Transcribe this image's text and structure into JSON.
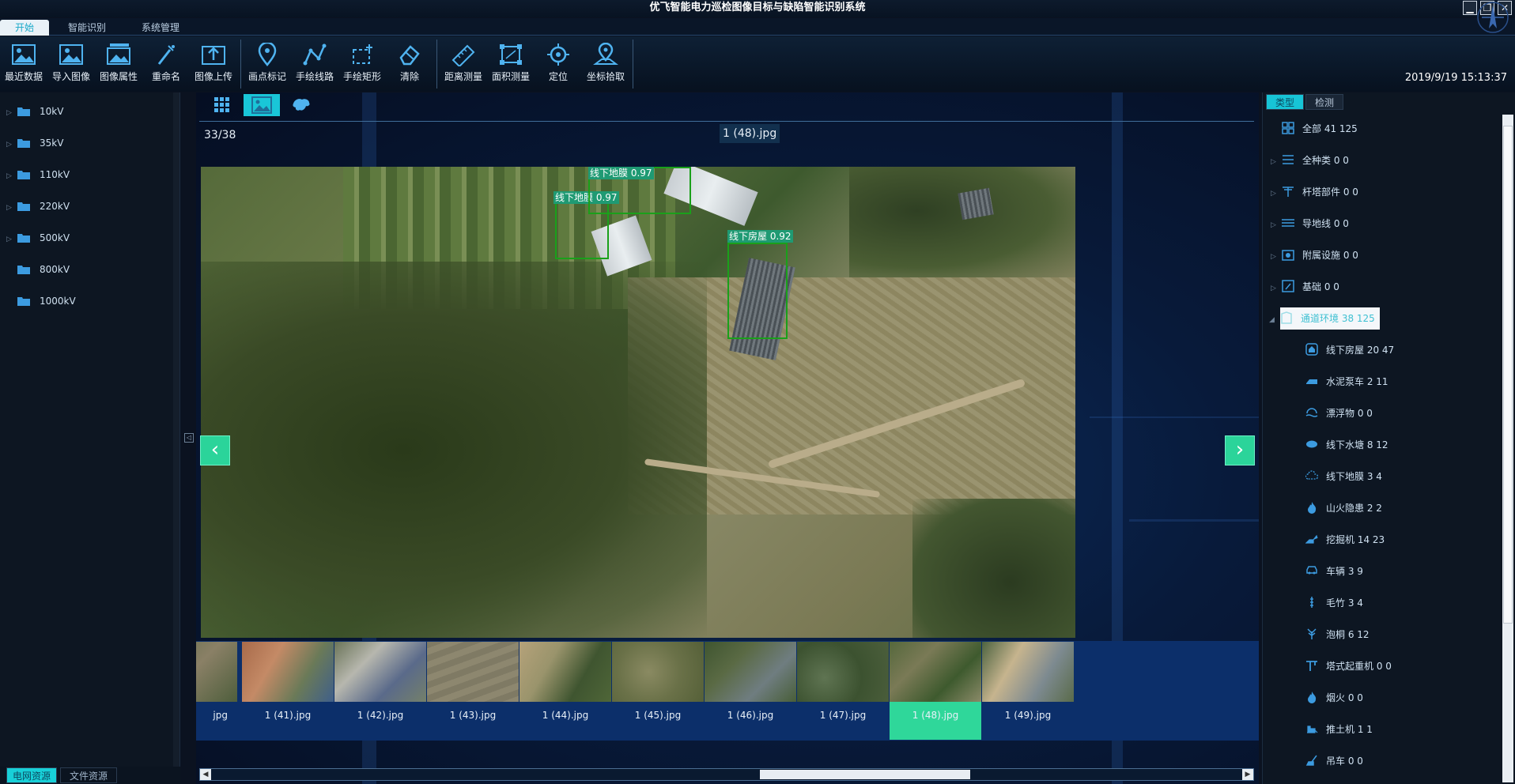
{
  "window": {
    "title": "优飞智能电力巡检图像目标与缺陷智能识别系统",
    "controls": [
      "▁",
      "❐",
      "✕"
    ]
  },
  "menu": [
    {
      "label": "开始",
      "active": true
    },
    {
      "label": "智能识别",
      "active": false
    },
    {
      "label": "系统管理",
      "active": false
    }
  ],
  "toolbar": {
    "groups": [
      [
        {
          "label": "最近数据",
          "icon": "recent-data-icon"
        },
        {
          "label": "导入图像",
          "icon": "import-image-icon"
        },
        {
          "label": "图像属性",
          "icon": "image-properties-icon"
        },
        {
          "label": "重命名",
          "icon": "rename-icon"
        },
        {
          "label": "图像上传",
          "icon": "upload-image-icon"
        }
      ],
      [
        {
          "label": "画点标记",
          "icon": "point-marker-icon"
        },
        {
          "label": "手绘线路",
          "icon": "draw-line-icon"
        },
        {
          "label": "手绘矩形",
          "icon": "draw-rectangle-icon"
        },
        {
          "label": "清除",
          "icon": "eraser-icon"
        }
      ],
      [
        {
          "label": "距离测量",
          "icon": "ruler-icon"
        },
        {
          "label": "面积测量",
          "icon": "area-measure-icon"
        },
        {
          "label": "定位",
          "icon": "locate-icon"
        },
        {
          "label": "坐标拾取",
          "icon": "coordinate-pick-icon"
        }
      ]
    ],
    "datetime": "2019/9/19 15:13:37"
  },
  "left_tree": {
    "items": [
      {
        "label": "10kV",
        "expandable": true
      },
      {
        "label": "35kV",
        "expandable": true
      },
      {
        "label": "110kV",
        "expandable": true
      },
      {
        "label": "220kV",
        "expandable": true
      },
      {
        "label": "500kV",
        "expandable": true
      },
      {
        "label": "800kV",
        "expandable": false
      },
      {
        "label": "1000kV",
        "expandable": false
      }
    ],
    "tabs": [
      {
        "label": "电网资源",
        "active": true
      },
      {
        "label": "文件资源",
        "active": false
      }
    ]
  },
  "viewer": {
    "view_tabs": [
      {
        "icon": "grid-view-icon",
        "active": false
      },
      {
        "icon": "image-view-icon",
        "active": true
      },
      {
        "icon": "map-view-icon",
        "active": false
      }
    ],
    "counter": "33/38",
    "filename": "1 (48).jpg",
    "detections": [
      {
        "label": "线下地膜 0.97"
      },
      {
        "label": "线下地膜 0.97"
      },
      {
        "label": "线下房屋 0.92"
      }
    ],
    "prev_icon": "chevron-left-icon",
    "next_icon": "chevron-right-icon",
    "colors": {
      "accent": "#19c6d8",
      "box": "#1aa01a",
      "nav": "#2bd49a",
      "thumb_active": "#2fd79a"
    }
  },
  "filmstrip": [
    {
      "caption": "jpg",
      "active": false
    },
    {
      "caption": "1 (41).jpg",
      "active": false
    },
    {
      "caption": "1 (42).jpg",
      "active": false
    },
    {
      "caption": "1 (43).jpg",
      "active": false
    },
    {
      "caption": "1 (44).jpg",
      "active": false
    },
    {
      "caption": "1 (45).jpg",
      "active": false
    },
    {
      "caption": "1 (46).jpg",
      "active": false
    },
    {
      "caption": "1 (47).jpg",
      "active": false
    },
    {
      "caption": "1 (48).jpg",
      "active": true
    },
    {
      "caption": "1 (49).jpg",
      "active": false
    }
  ],
  "right_panel": {
    "tabs": [
      {
        "label": "类型",
        "active": true
      },
      {
        "label": "检测",
        "active": false
      }
    ],
    "items": [
      {
        "label": "全部 41 125",
        "level": 0,
        "icon": "all-grid-icon",
        "arrow": ""
      },
      {
        "label": "全种类 0 0",
        "level": 0,
        "icon": "list-icon",
        "arrow": "▷"
      },
      {
        "label": "杆塔部件 0 0",
        "level": 0,
        "icon": "tower-icon",
        "arrow": "▷"
      },
      {
        "label": "导地线 0 0",
        "level": 0,
        "icon": "wire-icon",
        "arrow": "▷"
      },
      {
        "label": "附属设施 0 0",
        "level": 0,
        "icon": "facility-icon",
        "arrow": "▷"
      },
      {
        "label": "基础 0 0",
        "level": 0,
        "icon": "foundation-icon",
        "arrow": "▷"
      },
      {
        "label": "通道环境 38 125",
        "level": 0,
        "icon": "channel-env-icon",
        "arrow": "◢",
        "selected": true
      },
      {
        "label": "线下房屋 20 47",
        "level": 1,
        "icon": "house-icon",
        "arrow": ""
      },
      {
        "label": "水泥泵车 2 11",
        "level": 1,
        "icon": "pump-truck-icon",
        "arrow": ""
      },
      {
        "label": "漂浮物 0 0",
        "level": 1,
        "icon": "floating-object-icon",
        "arrow": ""
      },
      {
        "label": "线下水塘 8 12",
        "level": 1,
        "icon": "pond-icon",
        "arrow": ""
      },
      {
        "label": "线下地膜 3 4",
        "level": 1,
        "icon": "film-cloud-icon",
        "arrow": ""
      },
      {
        "label": "山火隐患 2 2",
        "level": 1,
        "icon": "fire-icon",
        "arrow": ""
      },
      {
        "label": "挖掘机 14 23",
        "level": 1,
        "icon": "excavator-icon",
        "arrow": ""
      },
      {
        "label": "车辆 3 9",
        "level": 1,
        "icon": "vehicle-icon",
        "arrow": ""
      },
      {
        "label": "毛竹 3 4",
        "level": 1,
        "icon": "bamboo-icon",
        "arrow": ""
      },
      {
        "label": "泡桐 6 12",
        "level": 1,
        "icon": "tree-icon",
        "arrow": ""
      },
      {
        "label": "塔式起重机 0 0",
        "level": 1,
        "icon": "tower-crane-icon",
        "arrow": ""
      },
      {
        "label": "烟火 0 0",
        "level": 1,
        "icon": "smoke-fire-icon",
        "arrow": ""
      },
      {
        "label": "推土机 1 1",
        "level": 1,
        "icon": "bulldozer-icon",
        "arrow": ""
      },
      {
        "label": "吊车 0 0",
        "level": 1,
        "icon": "crane-icon",
        "arrow": ""
      }
    ]
  }
}
